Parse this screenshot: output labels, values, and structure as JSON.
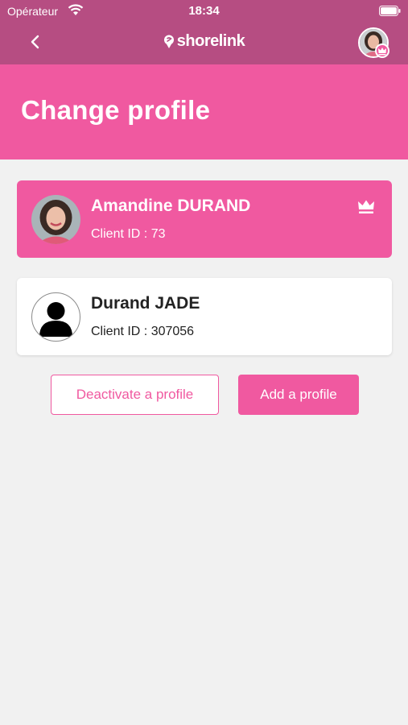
{
  "status_bar": {
    "carrier": "Opérateur",
    "time": "18:34"
  },
  "nav": {
    "logo_text": "shorelink",
    "back_icon": "chevron-left-icon",
    "avatar_badge_icon": "crown-icon"
  },
  "page": {
    "title": "Change profile"
  },
  "profiles": [
    {
      "name": "Amandine DURAND",
      "client_id": "Client ID : 73",
      "active": true,
      "owner_icon": "crown-icon",
      "avatar": "photo-avatar"
    },
    {
      "name": "Durand JADE",
      "client_id": "Client ID : 307056",
      "active": false,
      "avatar": "default-user-icon"
    }
  ],
  "actions": {
    "deactivate_label": "Deactivate a profile",
    "add_label": "Add a profile"
  },
  "colors": {
    "accent": "#f059a0",
    "nav_bar": "#b64d82",
    "background": "#f1f1f1"
  }
}
